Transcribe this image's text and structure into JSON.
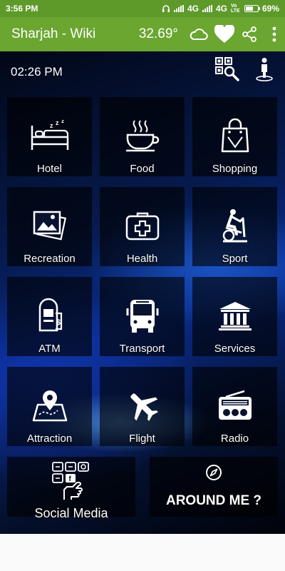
{
  "status_bar": {
    "time": "3:56 PM",
    "network1": "4G",
    "network2": "4G",
    "volte": "Vo LTE",
    "battery": "69%",
    "battery_level": 0.69
  },
  "app_bar": {
    "title": "Sharjah - Wiki",
    "temperature": "32.69°",
    "weather_icon": "cloud-icon",
    "favorite_icon": "heart-icon",
    "share_icon": "share-icon",
    "menu_icon": "more-vert-icon"
  },
  "main": {
    "time": "02:26 PM",
    "tiles": [
      {
        "label": "Hotel",
        "icon": "bed-icon"
      },
      {
        "label": "Food",
        "icon": "coffee-cup-icon"
      },
      {
        "label": "Shopping",
        "icon": "shopping-bag-icon"
      },
      {
        "label": "Recreation",
        "icon": "pictures-icon"
      },
      {
        "label": "Health",
        "icon": "first-aid-kit-icon"
      },
      {
        "label": "Sport",
        "icon": "exercise-bike-icon"
      },
      {
        "label": "ATM",
        "icon": "atm-icon"
      },
      {
        "label": "Transport",
        "icon": "bus-icon"
      },
      {
        "label": "Services",
        "icon": "government-building-icon"
      },
      {
        "label": "Attraction",
        "icon": "map-pin-icon"
      },
      {
        "label": "Flight",
        "icon": "airplane-icon"
      },
      {
        "label": "Radio",
        "icon": "radio-icon"
      }
    ],
    "social_media": {
      "label": "Social Media",
      "icon": "social-media-hand-icon"
    },
    "around_me": {
      "label": "AROUND ME ?",
      "icon": "compass-icon"
    }
  }
}
